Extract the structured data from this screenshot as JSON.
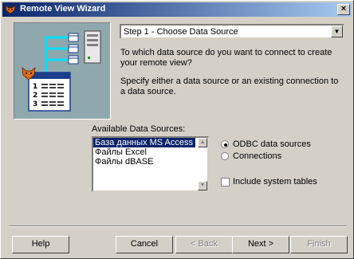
{
  "window": {
    "title": "Remote View Wizard",
    "close_label": "×"
  },
  "step_select": {
    "value": "Step 1 - Choose Data Source"
  },
  "question": "To which data source do you want to connect to create your remote view?",
  "instruction": "Specify either a data source or an existing connection to a data source.",
  "sources": {
    "label": "Available Data Sources:",
    "items": [
      "База данных MS Access",
      "Файлы Excel",
      "Файлы dBASE"
    ],
    "selected_index": 0
  },
  "options": {
    "odbc_label": "ODBC data sources",
    "connections_label": "Connections",
    "selected": "odbc",
    "include_system_tables_label": "Include system tables",
    "include_system_tables_checked": false
  },
  "buttons": {
    "help": "Help",
    "cancel": "Cancel",
    "back": "< Back",
    "next": "Next >",
    "finish": "Finish"
  },
  "illustration": {
    "rows": [
      "1",
      "2",
      "3"
    ]
  },
  "colors": {
    "titlebar_start": "#0a246a",
    "titlebar_end": "#a6caf0",
    "selection": "#0a246a",
    "illustration_bg": "#8fa8ad"
  }
}
